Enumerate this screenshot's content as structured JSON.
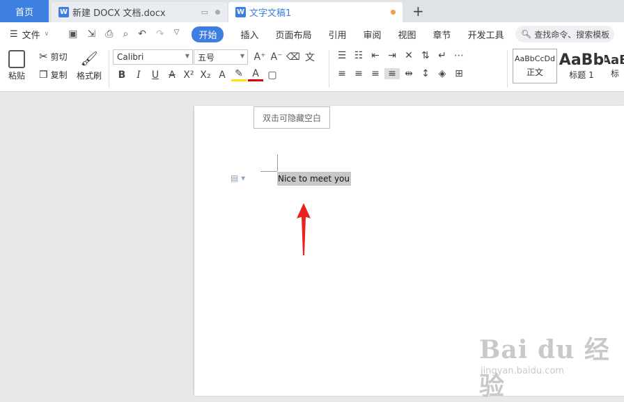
{
  "tabs": {
    "home": "首页",
    "doc1": "新建 DOCX 文档.docx",
    "doc2": "文字文稿1",
    "new_tab": "+"
  },
  "menubar": {
    "file": "文件",
    "items": [
      "开始",
      "插入",
      "页面布局",
      "引用",
      "审阅",
      "视图",
      "章节",
      "开发工具"
    ],
    "active_index": 0,
    "search_placeholder": "查找命令、搜索模板"
  },
  "ribbon": {
    "paste": "粘贴",
    "cut": "剪切",
    "copy": "复制",
    "format_painter": "格式刷",
    "font_family": "Calibri",
    "font_size": "五号",
    "styles": [
      {
        "preview": "AaBbCcDd",
        "name": "正文"
      },
      {
        "preview": "AaBb",
        "name": "标题 1"
      },
      {
        "preview": "AaB",
        "name": "标"
      }
    ]
  },
  "document": {
    "hide_whitespace_hint": "双击可隐藏空白",
    "selected_text": "Nice to meet you"
  },
  "watermark": {
    "brand": "Bai du 经验",
    "url": "jingyan.baidu.com"
  },
  "colors": {
    "accent": "#3d7fe0",
    "selection": "#c8c8c8",
    "arrow": "#e8231f",
    "unsaved_dot": "#f29b4b"
  }
}
